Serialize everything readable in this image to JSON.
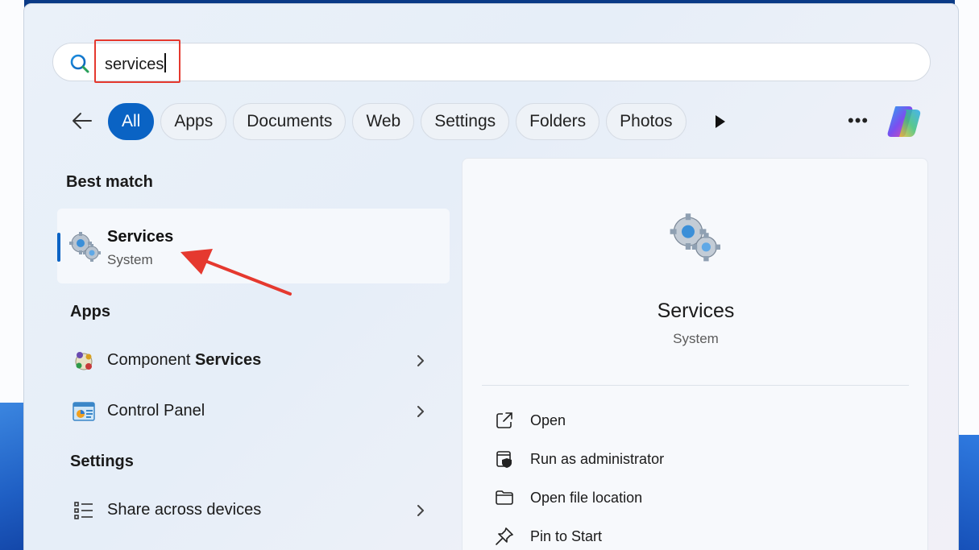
{
  "search": {
    "query": "services"
  },
  "filters": {
    "chips": [
      "All",
      "Apps",
      "Documents",
      "Web",
      "Settings",
      "Folders",
      "Photos"
    ],
    "active": "All",
    "more": "•••"
  },
  "sections": {
    "best_match": "Best match",
    "apps": "Apps",
    "settings": "Settings"
  },
  "best_match": {
    "title": "Services",
    "subtitle": "System"
  },
  "apps": [
    {
      "prefix": "Component ",
      "bold": "Services"
    },
    {
      "prefix": "Control Panel",
      "bold": ""
    }
  ],
  "settings_items": [
    {
      "label": "Share across devices"
    }
  ],
  "preview": {
    "title": "Services",
    "subtitle": "System",
    "actions": [
      "Open",
      "Run as administrator",
      "Open file location",
      "Pin to Start"
    ]
  },
  "colors": {
    "accent": "#0a63c4",
    "highlight_box": "#e5392f",
    "annotation_arrow": "#e5392f"
  },
  "icons": {
    "search": "search-icon",
    "back": "back-arrow-icon",
    "play": "play-icon",
    "copilot": "copilot-icon",
    "services": "gear-services-icon",
    "component_services": "component-services-icon",
    "control_panel": "control-panel-icon",
    "share": "share-list-icon",
    "chevron": "chevron-right-icon",
    "open": "open-external-icon",
    "admin": "shield-admin-icon",
    "folder": "folder-icon",
    "pin": "pin-icon"
  }
}
